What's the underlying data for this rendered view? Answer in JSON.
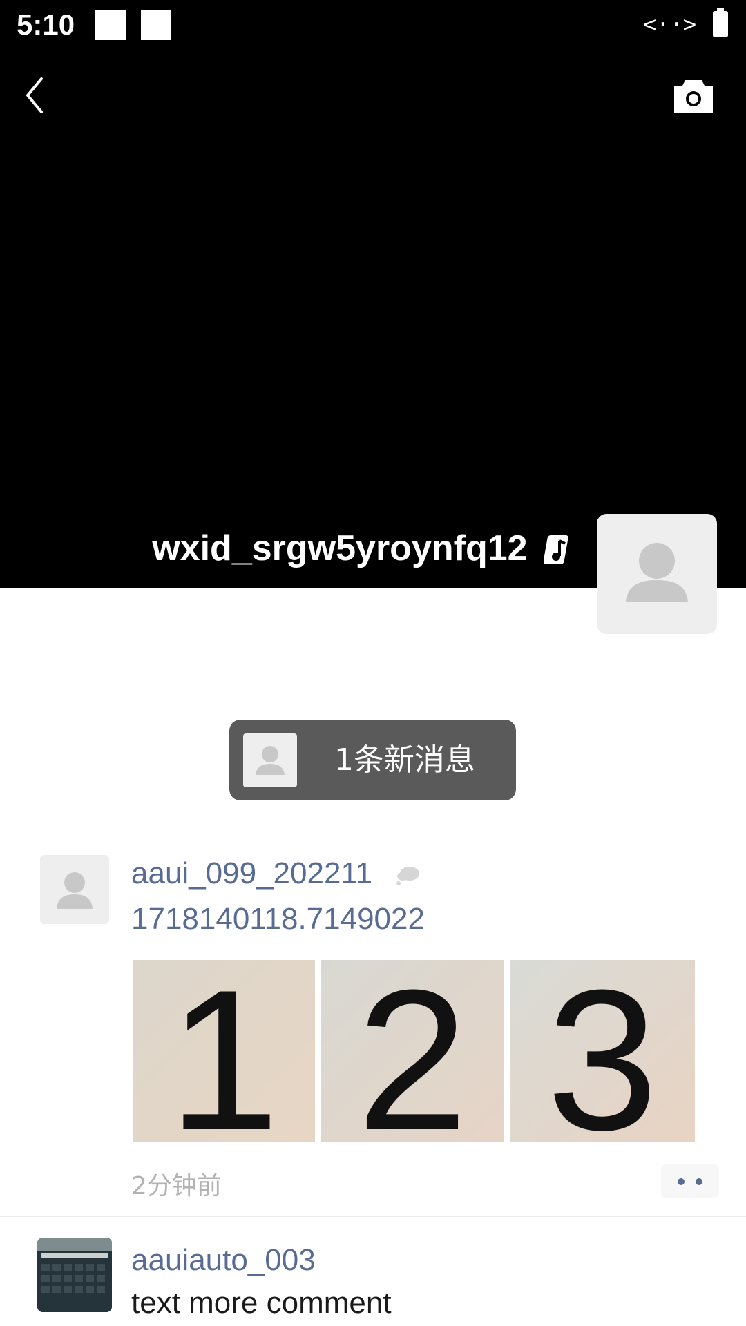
{
  "status_bar": {
    "time": "5:10",
    "network_glyph": "<··>"
  },
  "header": {
    "back_icon": "chevron-left-icon",
    "camera_icon": "camera-icon"
  },
  "profile": {
    "nickname": "wxid_srgw5yroynfq12",
    "music_icon": "music-note-icon"
  },
  "new_messages": {
    "label": "1条新消息"
  },
  "post1": {
    "username": "aaui_099_202211",
    "text": "1718140118.7149022",
    "photos": [
      "1",
      "2",
      "3"
    ],
    "time": "2分钟前"
  },
  "post2": {
    "username": "aauiauto_003",
    "text": "text more comment"
  },
  "colors": {
    "link": "#576b95",
    "cover": "#000000",
    "badge_bg": "#5a5a5a"
  }
}
